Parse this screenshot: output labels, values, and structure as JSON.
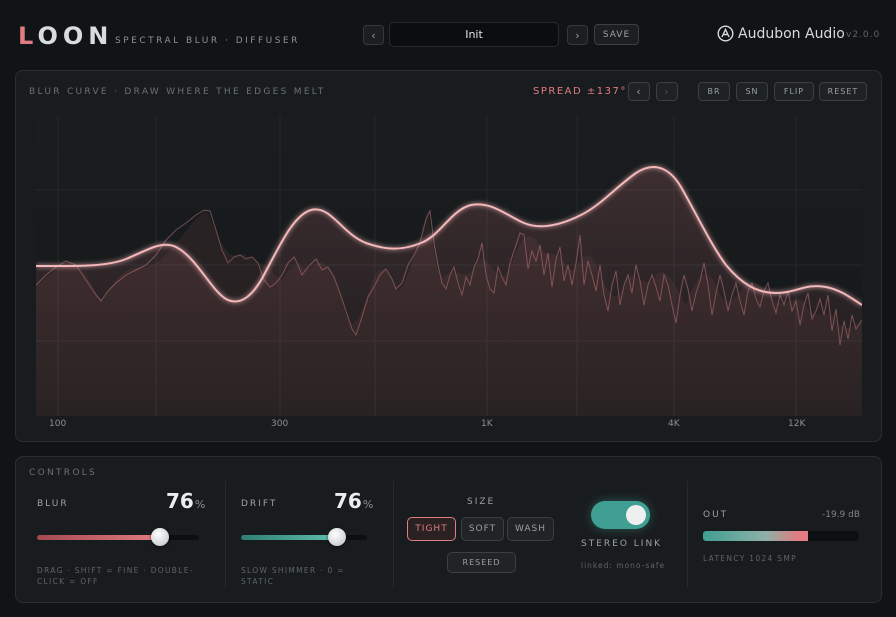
{
  "header": {
    "logo_first": "L",
    "logo_rest": "OON",
    "tagline": "SPECTRAL BLUR · DIFFUSER",
    "prev_icon": "‹",
    "next_icon": "›",
    "preset_name": "Init",
    "save_label": "SAVE",
    "brand": "Audubon Audio",
    "brand_icon": "audubon-logo-icon",
    "version": "v2.0.0"
  },
  "curve_panel": {
    "label": "BLUR CURVE · DRAW WHERE THE EDGES MELT",
    "spread": "SPREAD ±137°",
    "undo_icon": "‹",
    "redo_icon": "›",
    "buttons": [
      "BR",
      "SN",
      "FLIP",
      "RESET"
    ],
    "freq_labels": [
      "100",
      "300",
      "1K",
      "4K",
      "12K"
    ]
  },
  "controls": {
    "label": "CONTROLS",
    "blur": {
      "title": "BLUR",
      "value": "76",
      "unit": "%",
      "level": 0.76,
      "hint": "DRAG · SHIFT = FINE · DOUBLE-CLICK = OFF"
    },
    "drift": {
      "title": "DRIFT",
      "value": "76",
      "unit": "%",
      "level": 0.76,
      "hint": "SLOW SHIMMER · 0 = STATIC"
    },
    "size": {
      "title": "SIZE",
      "options": [
        "TIGHT",
        "SOFT",
        "WASH"
      ],
      "selected": "TIGHT",
      "reseed": "RESEED"
    },
    "stereo": {
      "title": "STEREO LINK",
      "sub": "linked: mono-safe",
      "on": true
    },
    "out": {
      "title": "OUT",
      "value": "-19.9 dB",
      "level": 0.67,
      "latency": "LATENCY 1024 SMP"
    }
  },
  "colors": {
    "accent_pink": "#e07c82",
    "accent_teal": "#3f9f92",
    "background": "#111416"
  }
}
